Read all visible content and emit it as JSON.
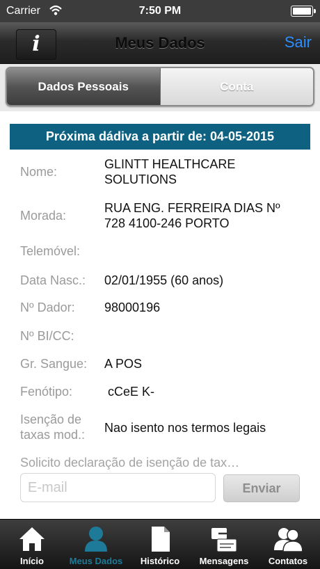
{
  "status_bar": {
    "carrier": "Carrier",
    "time": "7:50 PM"
  },
  "nav": {
    "title": "Meus Dados",
    "info_label": "i",
    "logout_label": "Sair"
  },
  "segments": [
    {
      "label": "Dados Pessoais",
      "selected": true
    },
    {
      "label": "Conta",
      "selected": false
    }
  ],
  "banner": "Próxima dádiva a partir de: 04-05-2015",
  "fields": [
    {
      "label": "Nome:",
      "value_lines": [
        "GLINTT HEALTHCARE",
        "SOLUTIONS"
      ]
    },
    {
      "label": "Morada:",
      "value_lines": [
        "RUA ENG. FERREIRA DIAS Nº",
        "728 4100-246 PORTO"
      ]
    },
    {
      "label": "Telemóvel:",
      "value_lines": [
        ""
      ]
    },
    {
      "label": "Data Nasc.:",
      "value_lines": [
        "02/01/1955 (60 anos)"
      ]
    },
    {
      "label": "Nº Dador:",
      "value_lines": [
        "98000196"
      ]
    },
    {
      "label": "Nº BI/CC:",
      "value_lines": [
        ""
      ]
    },
    {
      "label": "Gr. Sangue:",
      "value_lines": [
        "A POS"
      ]
    },
    {
      "label": "Fenótipo:",
      "value_lines": [
        " cCeE K-"
      ]
    },
    {
      "label_lines": [
        "Isenção de",
        "taxas mod.:"
      ],
      "value_lines": [
        "Nao isento nos termos legais"
      ]
    }
  ],
  "exemption": {
    "request_text": "Solicito declaração de isenção de tax…",
    "email_placeholder": "E-mail",
    "email_value": "",
    "send_label": "Enviar"
  },
  "tabs": [
    {
      "label": "Início",
      "icon": "home-icon",
      "active": false
    },
    {
      "label": "Meus Dados",
      "icon": "user-icon",
      "active": true
    },
    {
      "label": "Histórico",
      "icon": "document-icon",
      "active": false
    },
    {
      "label": "Mensagens",
      "icon": "messages-icon",
      "active": false
    },
    {
      "label": "Contatos",
      "icon": "contacts-icon",
      "active": false
    }
  ],
  "colors": {
    "accent": "#0e6180",
    "link": "#2a8fff",
    "active_tab": "#1d7a99"
  }
}
